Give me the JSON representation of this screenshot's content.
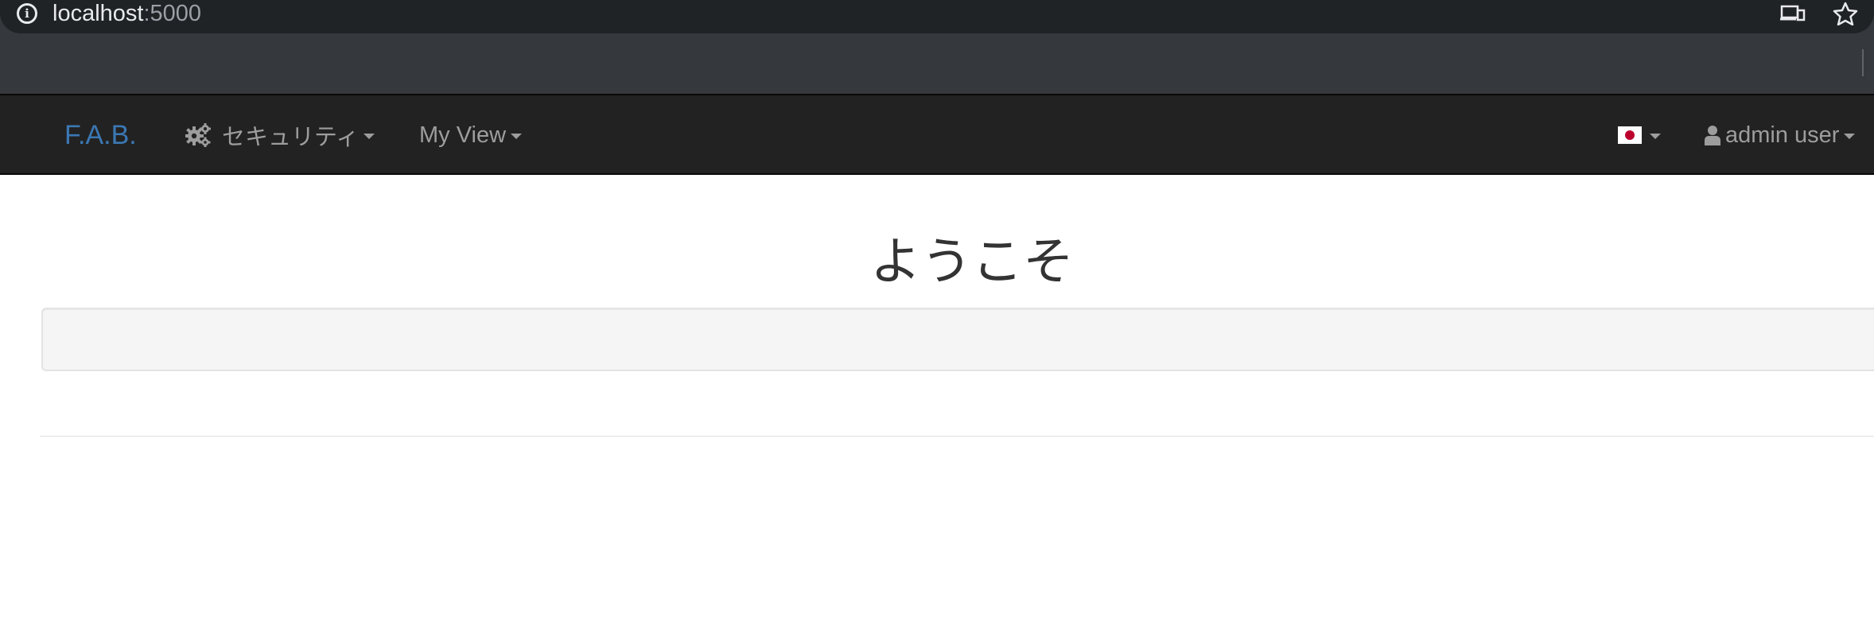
{
  "browser": {
    "url_host": "localhost",
    "url_port": ":5000",
    "icons": [
      "info-icon",
      "devices-icon",
      "star-icon"
    ]
  },
  "navbar": {
    "brand": "F.A.B.",
    "menus": [
      {
        "label": "セキュリティ",
        "icon": "gears-icon"
      },
      {
        "label": "My View"
      }
    ],
    "language": {
      "flag": "japan-flag-icon"
    },
    "user": {
      "label": "admin user",
      "icon": "user-icon"
    }
  },
  "content": {
    "title": "ようこそ"
  },
  "colors": {
    "navbar_bg": "#222222",
    "brand": "#3b78b4",
    "nav_text": "#9d9d9d",
    "well_bg": "#f5f5f5"
  }
}
